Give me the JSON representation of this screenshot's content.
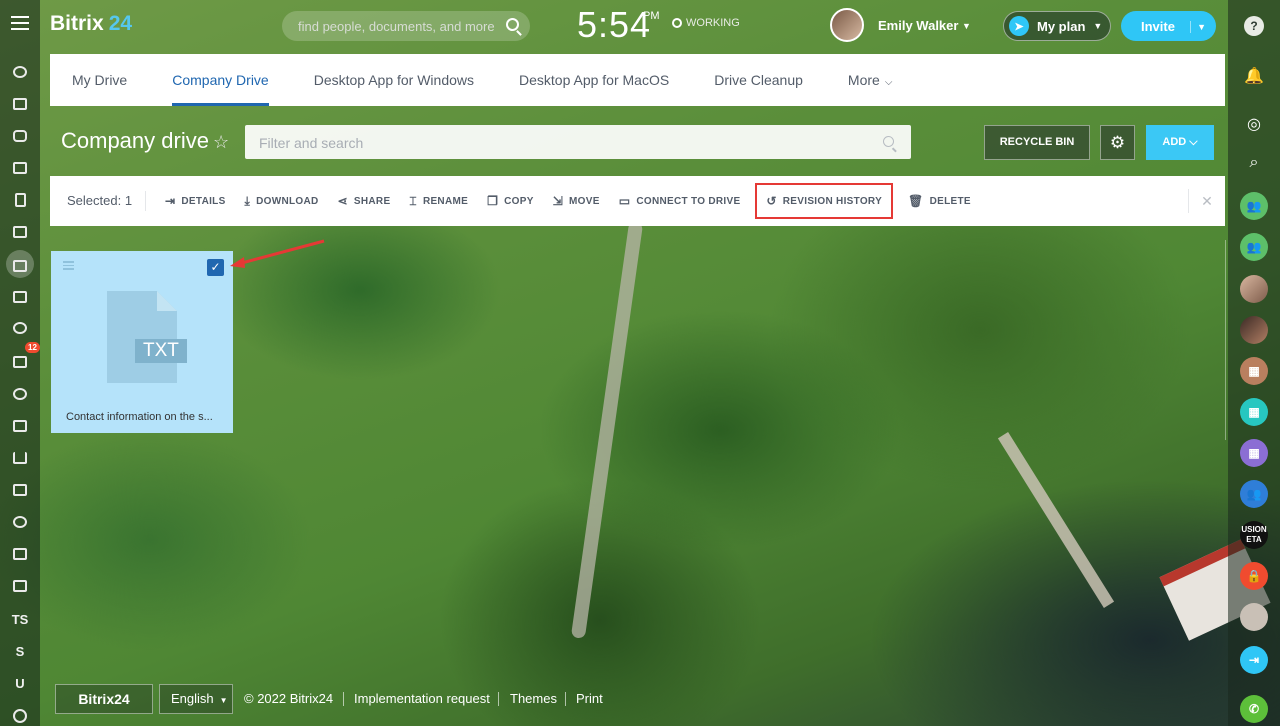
{
  "header": {
    "logo_name": "Bitrix",
    "logo_num": "24",
    "search_placeholder": "find people, documents, and more",
    "clock_time": "5:54",
    "clock_ampm": "PM",
    "work_status": "WORKING",
    "user_name": "Emily Walker",
    "plan_label": "My plan",
    "invite_label": "Invite"
  },
  "tabs": [
    {
      "label": "My Drive"
    },
    {
      "label": "Company Drive"
    },
    {
      "label": "Desktop App for Windows"
    },
    {
      "label": "Desktop App for MacOS"
    },
    {
      "label": "Drive Cleanup"
    },
    {
      "label": "More"
    }
  ],
  "page": {
    "title": "Company drive",
    "filter_placeholder": "Filter and search",
    "recycle_bin": "RECYCLE BIN",
    "add_label": "ADD"
  },
  "toolbar": {
    "selected": "Selected: 1",
    "actions": [
      {
        "label": "DETAILS"
      },
      {
        "label": "DOWNLOAD"
      },
      {
        "label": "SHARE"
      },
      {
        "label": "RENAME"
      },
      {
        "label": "COPY"
      },
      {
        "label": "MOVE"
      },
      {
        "label": "CONNECT TO DRIVE"
      },
      {
        "label": "REVISION HISTORY"
      },
      {
        "label": "DELETE"
      }
    ]
  },
  "file": {
    "type_label": "TXT",
    "name": "Contact information on the s..."
  },
  "left_sidebar": {
    "badge_count": "12",
    "text_items": [
      "TS",
      "S",
      "U"
    ]
  },
  "right_sidebar": {
    "help": "?",
    "avatar_text": "USION ETA"
  },
  "footer": {
    "logo": "Bitrix24",
    "language": "English",
    "copyright": "© 2022 Bitrix24",
    "implementation": "Implementation request",
    "themes": "Themes",
    "print": "Print"
  },
  "colors": {
    "accent": "#2067b0",
    "add_button": "#3bc8f5",
    "highlight_box": "#e53935",
    "selected_card": "#b5e3fa"
  }
}
